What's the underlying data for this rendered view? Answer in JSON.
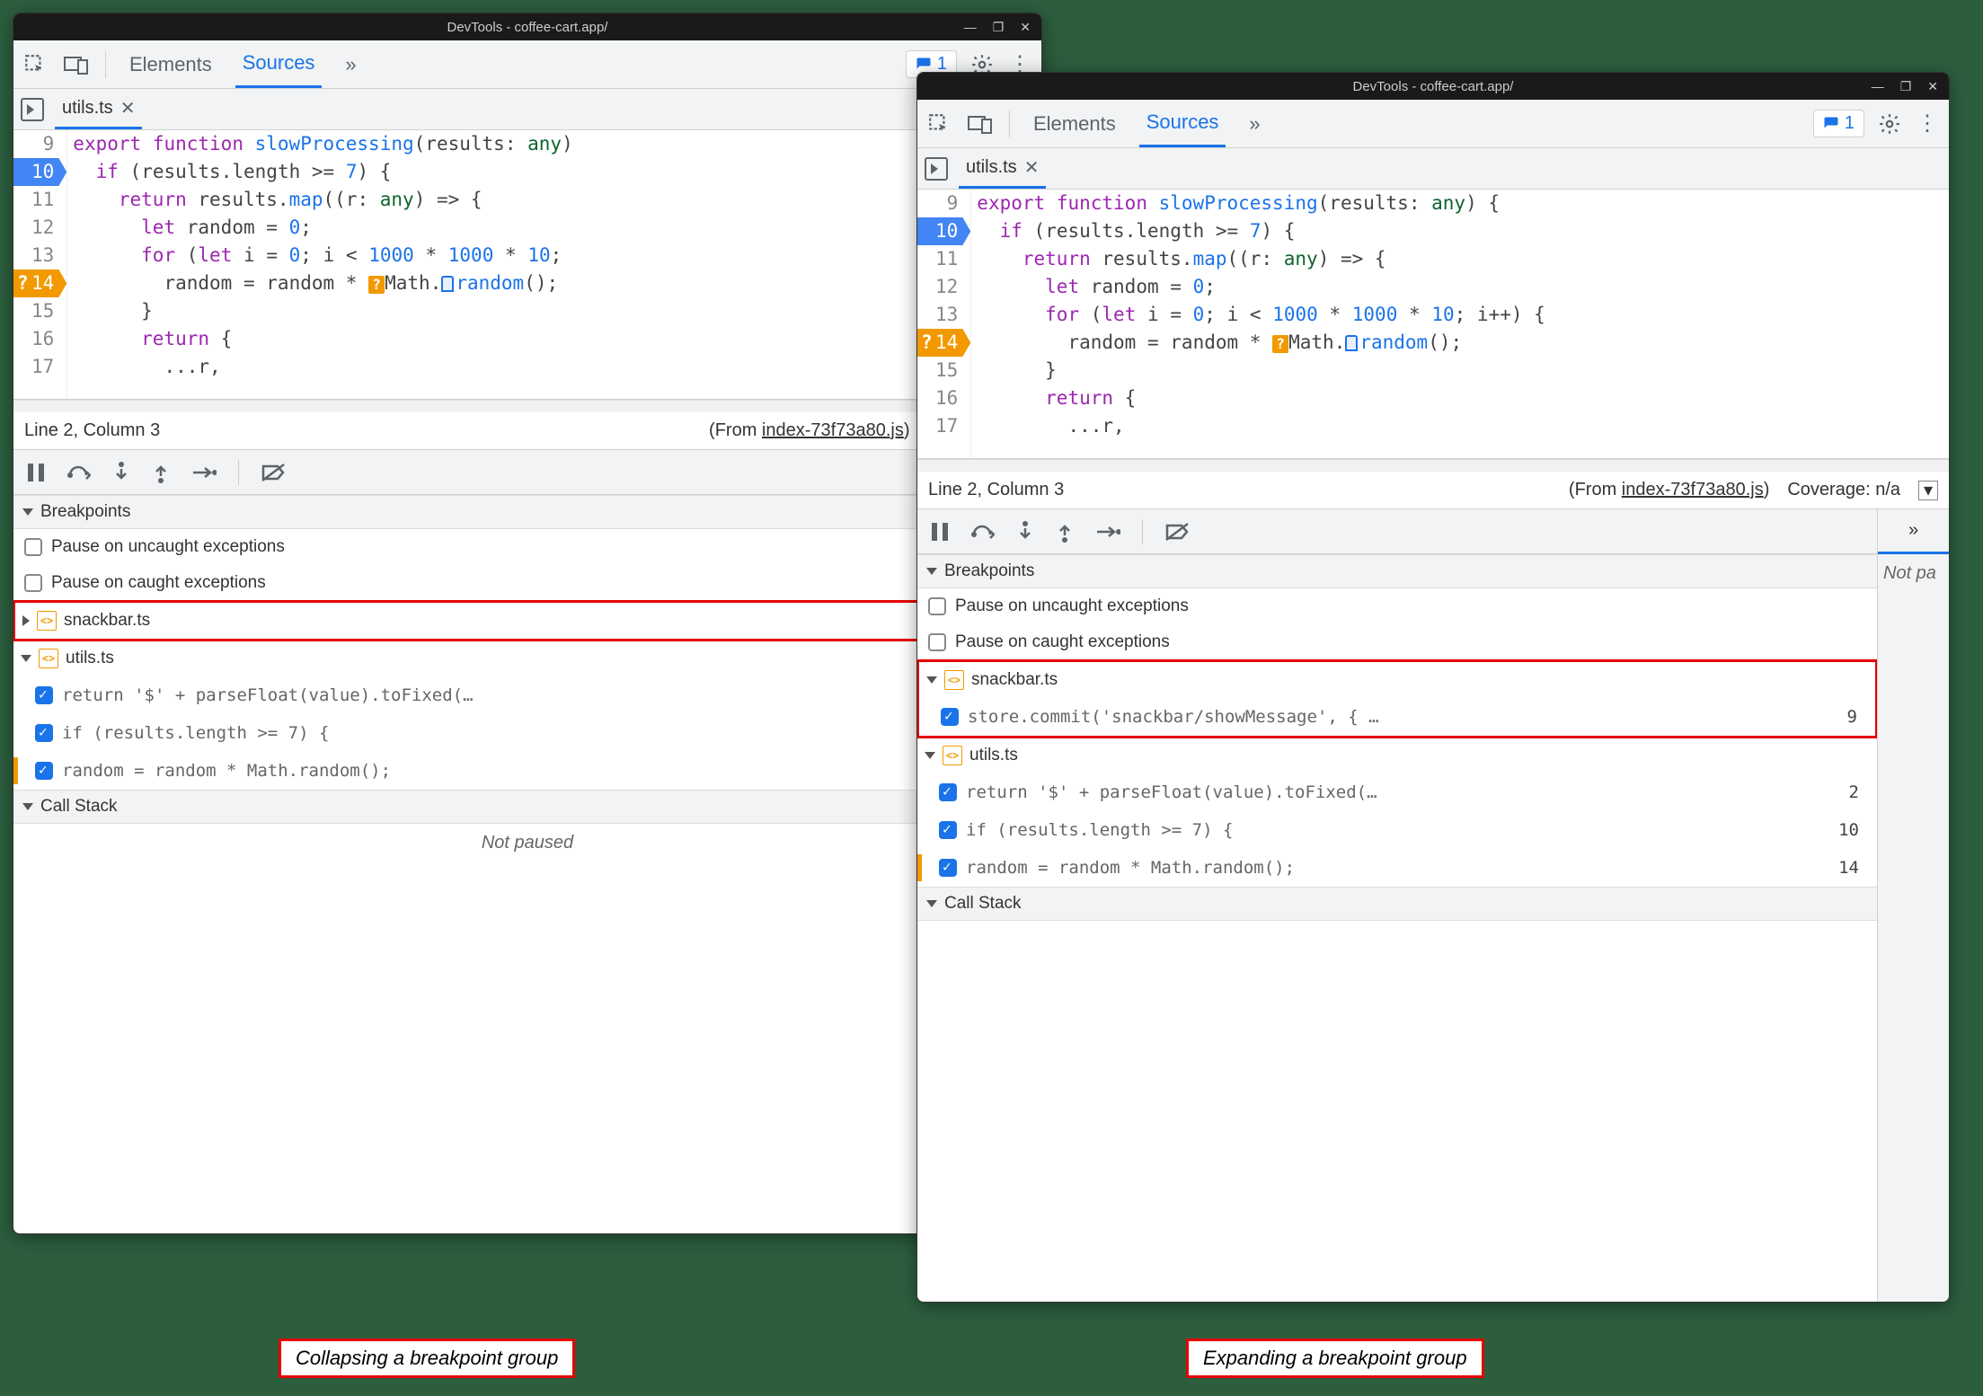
{
  "window_title": "DevTools - coffee-cart.app/",
  "panels": {
    "elements": "Elements",
    "sources": "Sources"
  },
  "issues_count": "1",
  "file_tab": "utils.ts",
  "code": {
    "lines": [
      {
        "n": 9,
        "html": "<span class='kw-export'>export</span> <span class='kw-func'>function</span> <span class='fn-name'>slowProcessing</span><span class='punct'>(</span><span class='ident'>results</span><span class='punct'>:</span> <span class='type'>any</span><span class='punct'>)</span>"
      },
      {
        "n": 10,
        "html": "  <span class='kw-if'>if</span> <span class='punct'>(</span><span class='ident'>results</span><span class='punct'>.</span><span class='ident'>length</span> <span class='punct'>&gt;=</span> <span class='num'>7</span><span class='punct'>) {</span>"
      },
      {
        "n": 11,
        "html": "    <span class='kw-return'>return</span> <span class='ident'>results</span><span class='punct'>.</span><span class='fn-name'>map</span><span class='punct'>((</span><span class='ident'>r</span><span class='punct'>:</span> <span class='type'>any</span><span class='punct'>) =&gt; {</span>"
      },
      {
        "n": 12,
        "html": "      <span class='kw-let'>let</span> <span class='ident'>random</span> <span class='punct'>=</span> <span class='num'>0</span><span class='punct'>;</span>"
      },
      {
        "n": 13,
        "html": "      <span class='kw-for'>for</span> <span class='punct'>(</span><span class='kw-let'>let</span> <span class='ident'>i</span> <span class='punct'>=</span> <span class='num'>0</span><span class='punct'>;</span> <span class='ident'>i</span> <span class='punct'>&lt;</span> <span class='num'>1000</span> <span class='punct'>*</span> <span class='num'>1000</span> <span class='punct'>*</span> <span class='num'>10</span><span class='punct'>;</span>"
      },
      {
        "n": 14,
        "html": "        <span class='ident'>random</span> <span class='punct'>=</span> <span class='ident'>random</span> <span class='punct'>*</span> <span class='math-badge'>?</span><span class='ident'>Math</span><span class='punct'>.</span><span class='rand-badge'></span><span class='fn-name'>random</span><span class='punct'>();</span>"
      },
      {
        "n": 15,
        "html": "      <span class='punct'>}</span>"
      },
      {
        "n": 16,
        "html": "      <span class='kw-return'>return</span> <span class='punct'>{</span>"
      },
      {
        "n": 17,
        "html": "        <span class='punct'>...</span><span class='ident'>r</span><span class='punct'>,</span>"
      }
    ]
  },
  "status": {
    "cursor": "Line 2, Column 3",
    "from_prefix": "(From ",
    "from_file": "index-73f73a80.js",
    "from_suffix": ")",
    "coverage_left": "Coverage: n/",
    "coverage_right": "Coverage: n/a"
  },
  "breakpoints": {
    "header": "Breakpoints",
    "pause_uncaught": "Pause on uncaught exceptions",
    "pause_caught": "Pause on caught exceptions",
    "groups": {
      "snackbar": {
        "file": "snackbar.ts",
        "entries": [
          {
            "code": "store.commit('snackbar/showMessage', { …",
            "line": "9"
          }
        ]
      },
      "utils": {
        "file": "utils.ts",
        "entries": [
          {
            "code": "return '$' + parseFloat(value).toFixed(…",
            "line": "2"
          },
          {
            "code": "if (results.length >= 7) {",
            "line": "10"
          },
          {
            "code": "random = random * Math.random();",
            "line": "14"
          }
        ]
      }
    }
  },
  "callstack": {
    "header": "Call Stack",
    "not_paused": "Not paused"
  },
  "side_panel": {
    "not_paused_short": "Not pa"
  },
  "captions": {
    "left": "Collapsing a breakpoint group",
    "right": "Expanding a breakpoint group"
  }
}
